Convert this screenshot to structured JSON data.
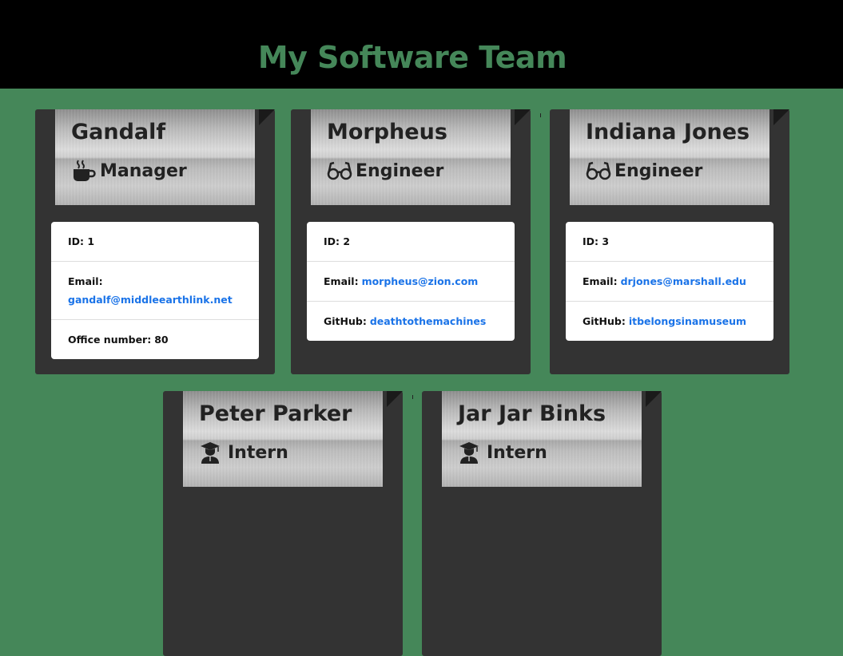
{
  "header": {
    "title": "My Software Team"
  },
  "colors": {
    "accent": "#458759",
    "header_bg": "#000000",
    "card_bg": "#333333",
    "link": "#1a73e8"
  },
  "employees": [
    {
      "name": "Gandalf",
      "role": "Manager",
      "icon": "coffee-cup-icon",
      "id_text": "ID: 1",
      "email_label": "Email:",
      "email": "gandalf@middleearthlink.net",
      "extra_label": "Office number:",
      "extra_value": "80"
    },
    {
      "name": "Morpheus",
      "role": "Engineer",
      "icon": "glasses-icon",
      "id_text": "ID: 2",
      "email_label": "Email:",
      "email": "morpheus@zion.com",
      "extra_label": "GitHub:",
      "extra_value": "deathtothemachines"
    },
    {
      "name": "Indiana Jones",
      "role": "Engineer",
      "icon": "glasses-icon",
      "id_text": "ID: 3",
      "email_label": "Email:",
      "email": "drjones@marshall.edu",
      "extra_label": "GitHub:",
      "extra_value": "itbelongsinamuseum"
    },
    {
      "name": "Peter Parker",
      "role": "Intern",
      "icon": "graduate-icon"
    },
    {
      "name": "Jar Jar Binks",
      "role": "Intern",
      "icon": "graduate-icon"
    }
  ]
}
